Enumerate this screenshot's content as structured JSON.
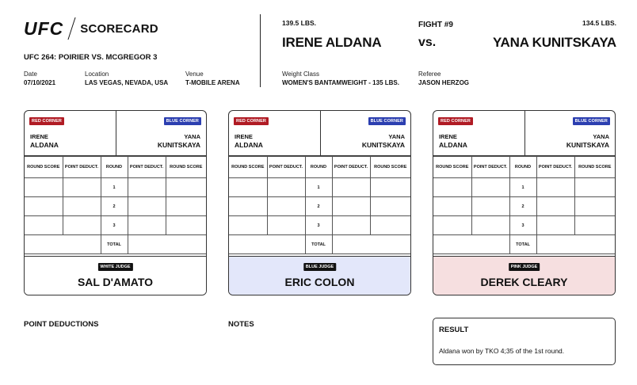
{
  "header": {
    "logo_text": "UFC",
    "section_title": "SCORECARD",
    "event": "UFC 264: POIRIER VS. MCGREGOR 3",
    "date_label": "Date",
    "date": "07/10/2021",
    "location_label": "Location",
    "location": "LAS VEGAS, NEVADA, USA",
    "venue_label": "Venue",
    "venue": "T-MOBILE ARENA"
  },
  "fight": {
    "red_weight": "139.5 LBS.",
    "red_name": "IRENE ALDANA",
    "fight_number": "FIGHT #9",
    "vs": "vs.",
    "blue_weight": "134.5 LBS.",
    "blue_name": "YANA KUNITSKAYA",
    "weight_class_label": "Weight Class",
    "weight_class": "WOMEN'S BANTAMWEIGHT - 135 LBS.",
    "referee_label": "Referee",
    "referee": "JASON HERZOG"
  },
  "card_labels": {
    "red_corner": "RED CORNER",
    "blue_corner": "BLUE CORNER",
    "red_first": "IRENE",
    "red_last": "ALDANA",
    "blue_first": "YANA",
    "blue_last": "KUNITSKAYA",
    "col_round_score": "ROUND SCORE",
    "col_point_deduct": "POINT DEDUCT.",
    "col_round": "ROUND",
    "rounds": [
      "1",
      "2",
      "3"
    ],
    "total": "TOTAL"
  },
  "judges": [
    {
      "badge": "WHITE JUDGE",
      "name": "SAL D'AMATO",
      "color": "#ffffff"
    },
    {
      "badge": "BLUE JUDGE",
      "name": "ERIC COLON",
      "color": "#e3e7fa"
    },
    {
      "badge": "PINK JUDGE",
      "name": "DEREK CLEARY",
      "color": "#f6dfe0"
    }
  ],
  "footer": {
    "point_deductions": "POINT DEDUCTIONS",
    "notes": "NOTES",
    "result_title": "RESULT",
    "result_text": "Aldana won by TKO 4;35 of the 1st round."
  },
  "colors": {
    "red_corner": "#b01b24",
    "blue_corner": "#2c3fb0"
  }
}
